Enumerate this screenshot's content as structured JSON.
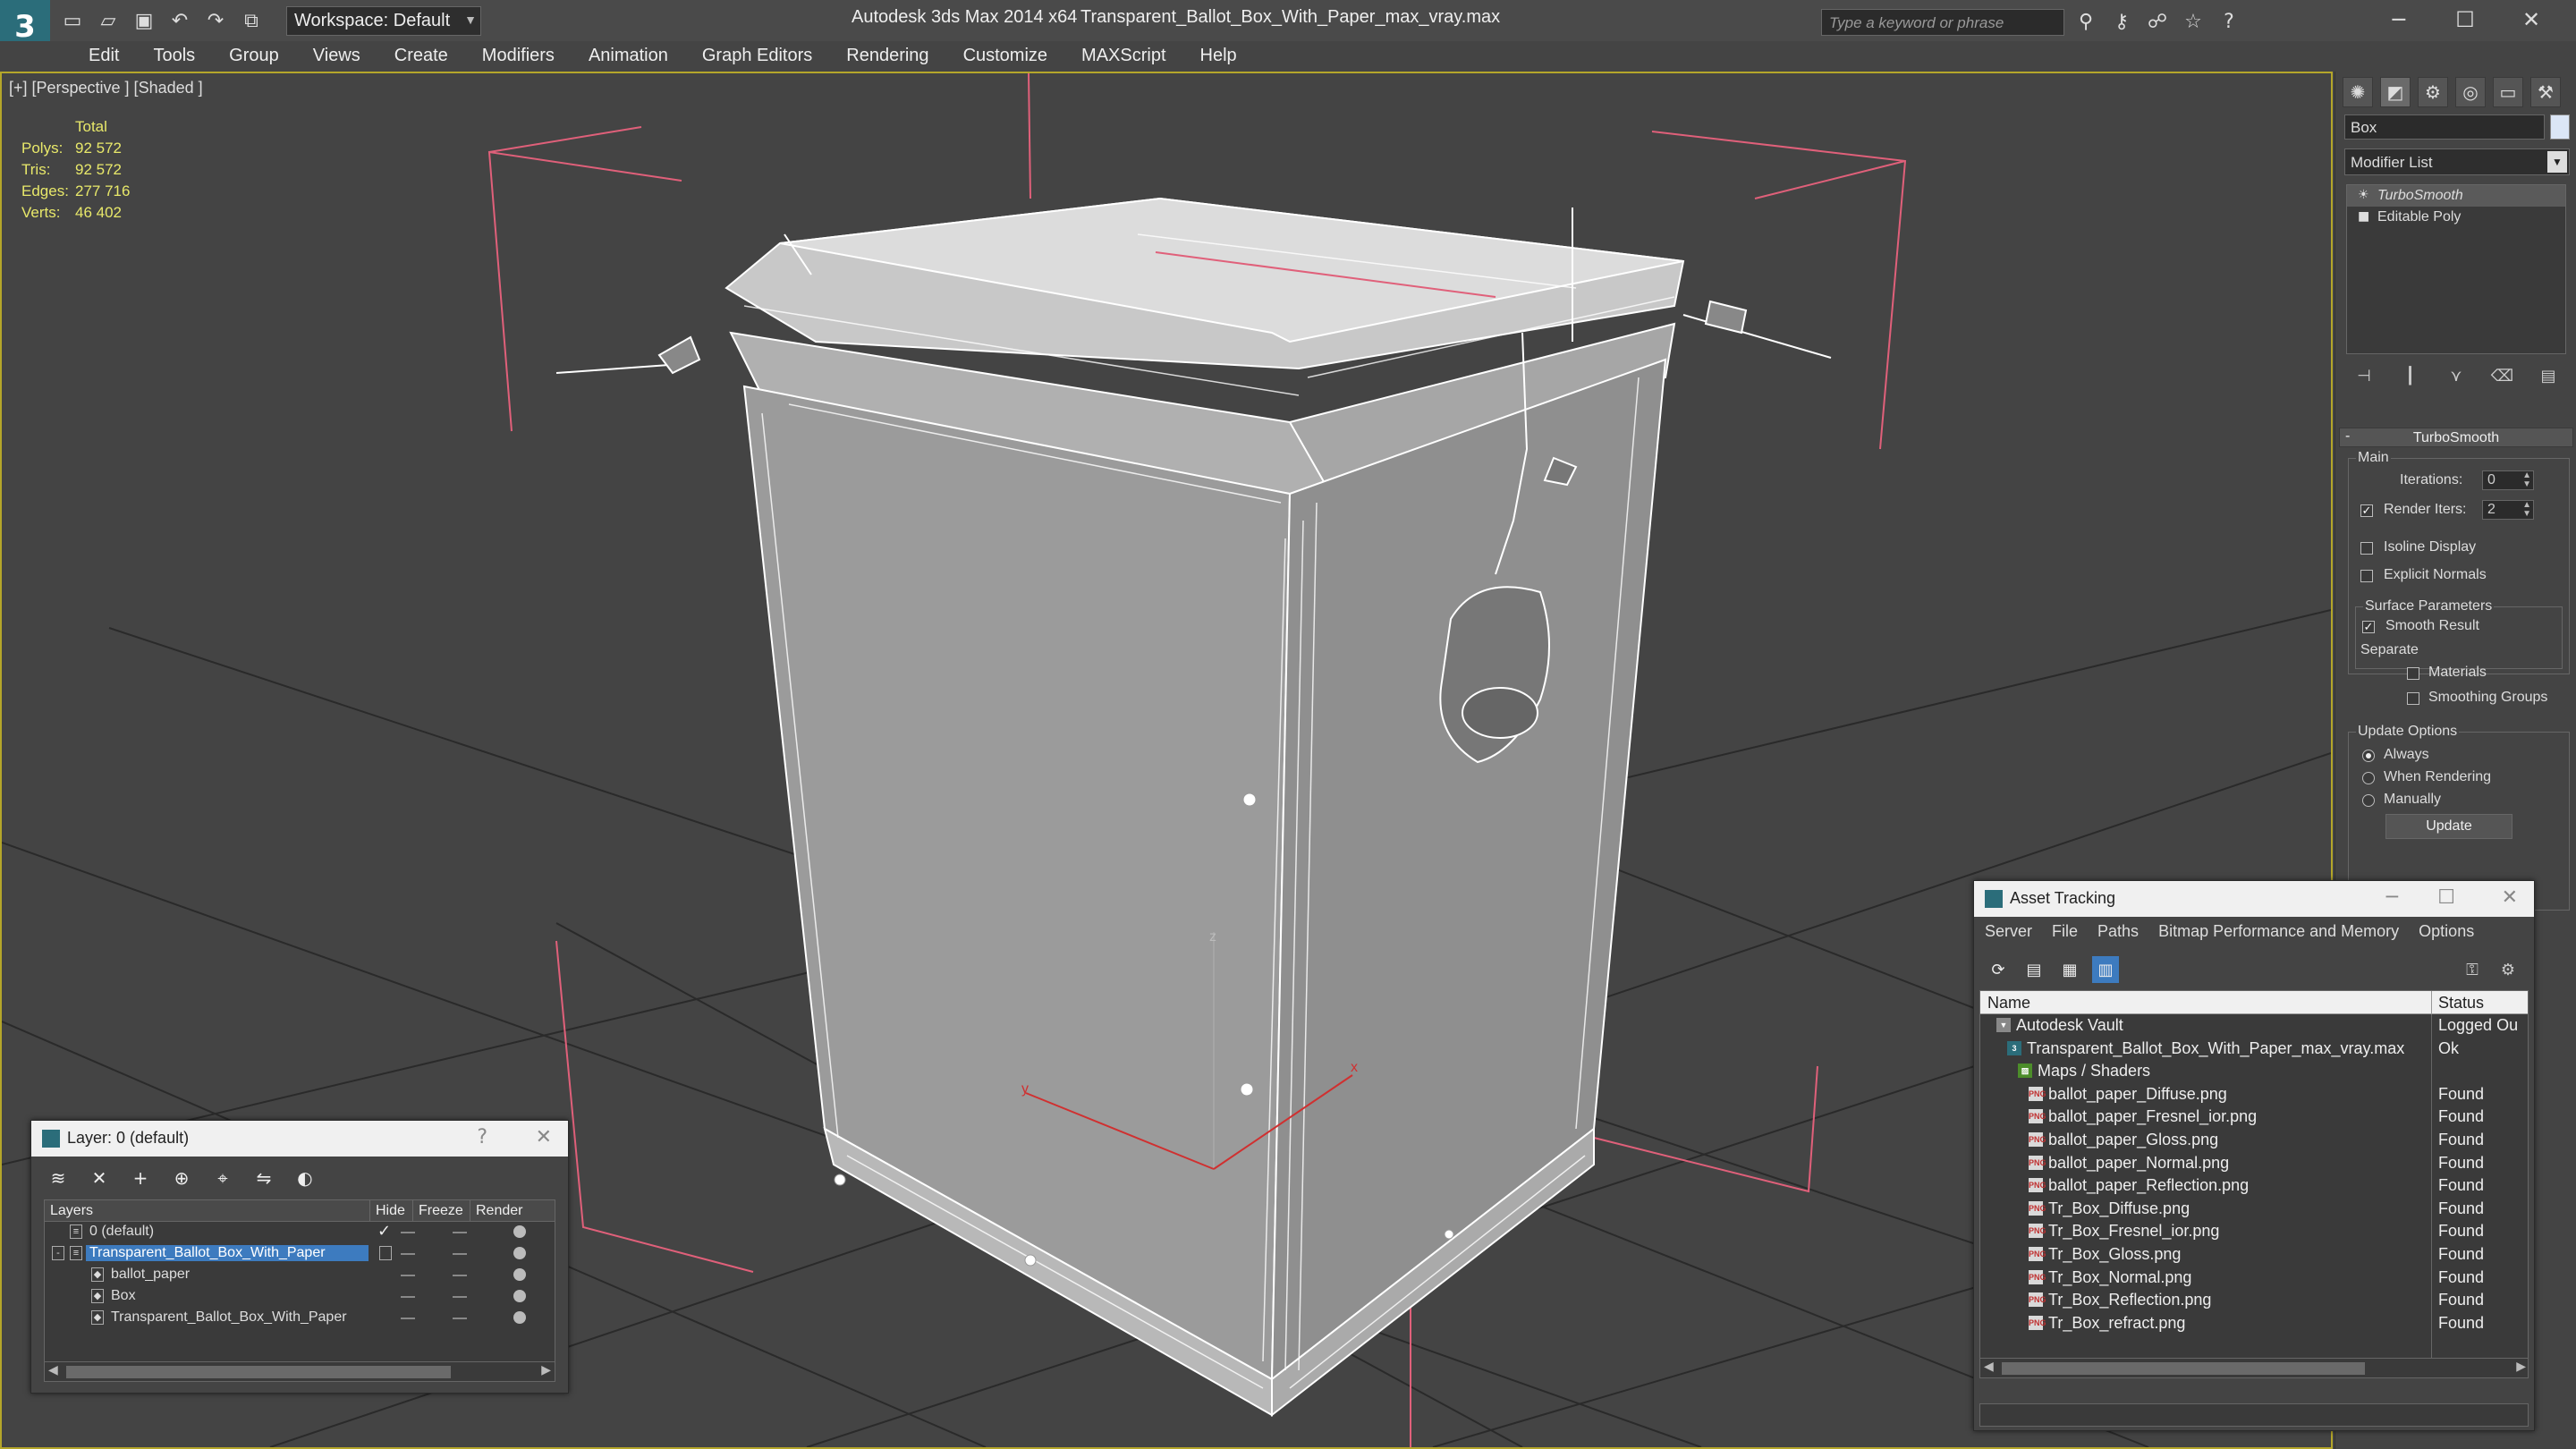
{
  "titlebar": {
    "logo_glyph": "3",
    "quick_access_icons": [
      "new-file-icon",
      "open-file-icon",
      "save-icon",
      "undo-icon",
      "redo-icon",
      "project-icon"
    ],
    "workspace_label": "Workspace: Default",
    "app_title": "Autodesk 3ds Max  2014 x64",
    "file_title": "Transparent_Ballot_Box_With_Paper_max_vray.max",
    "search_placeholder": "Type a keyword or phrase",
    "search_tools": [
      "binoculars-icon",
      "key-icon",
      "people-icon",
      "star-icon",
      "help-icon"
    ],
    "window_controls": [
      "minimize",
      "maximize",
      "close"
    ]
  },
  "menu": [
    "Edit",
    "Tools",
    "Group",
    "Views",
    "Create",
    "Modifiers",
    "Animation",
    "Graph Editors",
    "Rendering",
    "Customize",
    "MAXScript",
    "Help"
  ],
  "viewport": {
    "label": "[+] [Perspective ] [Shaded ]",
    "stats": {
      "total_label": "Total",
      "rows": [
        {
          "label": "Polys:",
          "value": "92 572"
        },
        {
          "label": "Tris:",
          "value": "92 572"
        },
        {
          "label": "Edges:",
          "value": "277 716"
        },
        {
          "label": "Verts:",
          "value": "46 402"
        }
      ]
    },
    "axis_labels": {
      "z": "z",
      "y": "y",
      "x": "x"
    },
    "colors": {
      "background": "#444444",
      "grid": "#2c2c2c",
      "wire": "#ffffff",
      "box_fill": "#9b9b9b",
      "bracket": "#e0607a",
      "border": "#b4a62a"
    }
  },
  "command_panel": {
    "tabs": [
      "create-icon",
      "modify-icon",
      "hierarchy-icon",
      "motion-icon",
      "display-icon",
      "utilities-icon"
    ],
    "object_name": "Box",
    "modifier_list": "Modifier List",
    "stack": [
      {
        "label": "TurboSmooth",
        "selected": true
      },
      {
        "label": "Editable Poly",
        "selected": false
      }
    ],
    "turbosmooth": {
      "title": "TurboSmooth",
      "main_label": "Main",
      "iterations_label": "Iterations:",
      "iterations": "0",
      "render_iters_label": "Render Iters:",
      "render_iters": "2",
      "render_iters_checked": true,
      "isoline_label": "Isoline Display",
      "explicit_label": "Explicit Normals",
      "surface_label": "Surface Parameters",
      "smooth_result_label": "Smooth Result",
      "separate_label": "Separate",
      "materials_label": "Materials",
      "smoothing_groups_label": "Smoothing Groups",
      "update_options_label": "Update Options",
      "always_label": "Always",
      "when_rendering_label": "When Rendering",
      "manually_label": "Manually",
      "update_button": "Update"
    }
  },
  "layer_window": {
    "title": "Layer: 0 (default)",
    "help": "?",
    "close": "✕",
    "columns": [
      "Layers",
      "Hide",
      "Freeze",
      "Render"
    ],
    "rows": [
      {
        "name": "0 (default)",
        "indent": 0,
        "selected": false,
        "active": true
      },
      {
        "name": "Transparent_Ballot_Box_With_Paper",
        "indent": 0,
        "selected": true,
        "active": false
      },
      {
        "name": "ballot_paper",
        "indent": 1,
        "selected": false,
        "active": false
      },
      {
        "name": "Box",
        "indent": 1,
        "selected": false,
        "active": false
      },
      {
        "name": "Transparent_Ballot_Box_With_Paper",
        "indent": 1,
        "selected": false,
        "active": false
      }
    ]
  },
  "asset_window": {
    "title": "Asset Tracking",
    "menu": [
      "Server",
      "File",
      "Paths",
      "Bitmap Performance and Memory",
      "Options"
    ],
    "columns": {
      "name": "Name",
      "status": "Status"
    },
    "rows": [
      {
        "name": "Autodesk Vault",
        "status": "Logged Ou",
        "level": 0,
        "icon": "vault"
      },
      {
        "name": "Transparent_Ballot_Box_With_Paper_max_vray.max",
        "status": "Ok",
        "level": 1,
        "icon": "max"
      },
      {
        "name": "Maps / Shaders",
        "status": "",
        "level": 2,
        "icon": "map"
      },
      {
        "name": "ballot_paper_Diffuse.png",
        "status": "Found",
        "level": 3,
        "icon": "png"
      },
      {
        "name": "ballot_paper_Fresnel_ior.png",
        "status": "Found",
        "level": 3,
        "icon": "png"
      },
      {
        "name": "ballot_paper_Gloss.png",
        "status": "Found",
        "level": 3,
        "icon": "png"
      },
      {
        "name": "ballot_paper_Normal.png",
        "status": "Found",
        "level": 3,
        "icon": "png"
      },
      {
        "name": "ballot_paper_Reflection.png",
        "status": "Found",
        "level": 3,
        "icon": "png"
      },
      {
        "name": "Tr_Box_Diffuse.png",
        "status": "Found",
        "level": 3,
        "icon": "png"
      },
      {
        "name": "Tr_Box_Fresnel_ior.png",
        "status": "Found",
        "level": 3,
        "icon": "png"
      },
      {
        "name": "Tr_Box_Gloss.png",
        "status": "Found",
        "level": 3,
        "icon": "png"
      },
      {
        "name": "Tr_Box_Normal.png",
        "status": "Found",
        "level": 3,
        "icon": "png"
      },
      {
        "name": "Tr_Box_Reflection.png",
        "status": "Found",
        "level": 3,
        "icon": "png"
      },
      {
        "name": "Tr_Box_refract.png",
        "status": "Found",
        "level": 3,
        "icon": "png"
      }
    ]
  }
}
